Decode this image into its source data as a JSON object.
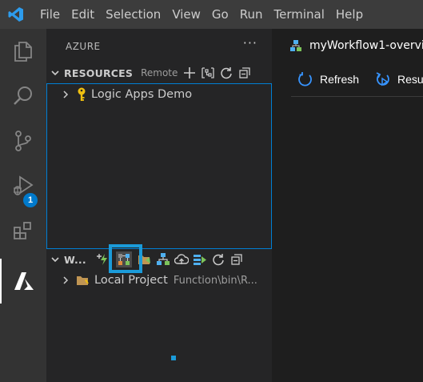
{
  "menubar": {
    "app_icon": "vscode-logo",
    "items": [
      "File",
      "Edit",
      "Selection",
      "View",
      "Go",
      "Run",
      "Terminal",
      "Help"
    ]
  },
  "activitybar": {
    "items": [
      {
        "icon": "explorer-icon"
      },
      {
        "icon": "search-icon"
      },
      {
        "icon": "source-control-icon"
      },
      {
        "icon": "run-debug-icon",
        "badge": "1"
      },
      {
        "icon": "extensions-icon"
      },
      {
        "icon": "azure-icon",
        "active": true
      }
    ]
  },
  "sidebar": {
    "title": "AZURE",
    "more": "···",
    "resources": {
      "title": "RESOURCES",
      "description": "Remote",
      "actions": [
        "add-icon",
        "group-by-icon",
        "refresh-icon",
        "collapse-all-icon"
      ],
      "items": [
        {
          "label": "Logic Apps Demo",
          "icon": "key-icon"
        }
      ]
    },
    "workspace": {
      "title": "W...",
      "actions": [
        "create-function-icon",
        "logic-app-icon",
        "open-folder-icon",
        "deploy-workflow-icon",
        "deploy-cloud-icon",
        "deploy-slot-icon",
        "refresh-icon",
        "collapse-all-icon"
      ],
      "items": [
        {
          "label": "Local Project",
          "description": "Function\\bin\\R...",
          "icon": "folder-icon"
        }
      ]
    }
  },
  "editor": {
    "tab": {
      "label": "myWorkflow1-overvi",
      "icon": "workflow-icon"
    },
    "toolbar": [
      {
        "label": "Refresh",
        "icon": "refresh-icon"
      },
      {
        "label": "Resu",
        "icon": "resubmit-icon"
      }
    ]
  },
  "colors": {
    "accent": "#007acc",
    "focus_border": "#007fd4",
    "highlight": "#1b9bd9",
    "key": "#f0c010"
  }
}
